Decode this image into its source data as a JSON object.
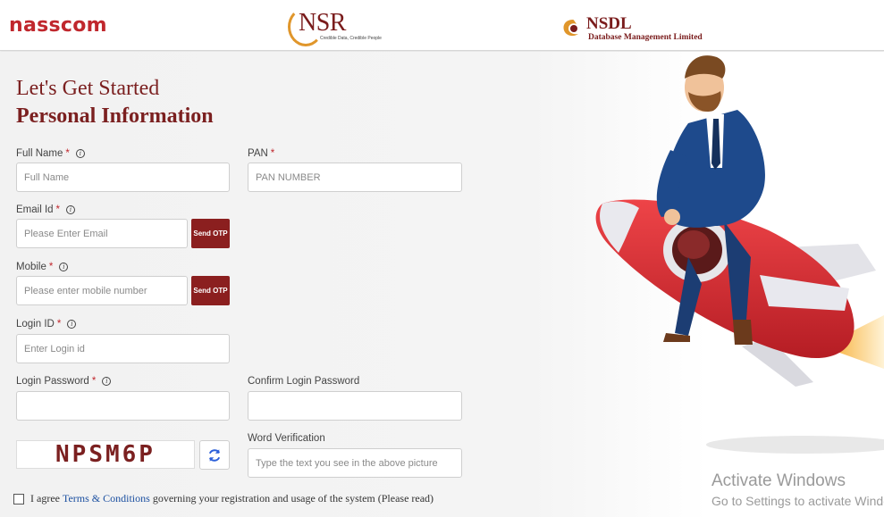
{
  "header": {
    "brand_nasscom": "nasscom",
    "brand_nsr": "NSR",
    "brand_nsr_tagline": "Credible Data, Credible People",
    "brand_nsdl": "NSDL",
    "brand_nsdl_sub": "Database Management Limited"
  },
  "form": {
    "title_line1": "Let's Get Started",
    "title_line2": "Personal Information",
    "required_mark": "*",
    "full_name": {
      "label": "Full Name",
      "placeholder": "Full Name",
      "value": ""
    },
    "pan": {
      "label": "PAN",
      "placeholder": "PAN NUMBER",
      "value": ""
    },
    "email": {
      "label": "Email Id",
      "placeholder": "Please Enter Email",
      "value": "",
      "otp_label": "Send OTP"
    },
    "mobile": {
      "label": "Mobile",
      "placeholder": "Please enter mobile number",
      "value": "",
      "otp_label": "Send OTP"
    },
    "login_id": {
      "label": "Login ID",
      "placeholder": "Enter Login id",
      "value": ""
    },
    "login_password": {
      "label": "Login Password",
      "placeholder": "",
      "value": ""
    },
    "confirm_password": {
      "label": "Confirm Login Password",
      "placeholder": "",
      "value": ""
    },
    "captcha": {
      "text": "NPSM6P",
      "refresh_icon": "refresh-icon"
    },
    "word_verification": {
      "label": "Word Verification",
      "placeholder": "Type the text you see in the above picture",
      "value": ""
    },
    "agree": {
      "prefix": "I agree",
      "link": "Terms & Conditions",
      "suffix": "governing your registration and usage of the system (Please read)",
      "checked": false
    }
  },
  "watermark": {
    "line1": "Activate Windows",
    "line2": "Go to Settings to activate Windows."
  },
  "colors": {
    "brand_red": "#c0272d",
    "title_maroon": "#7b2020",
    "button_maroon": "#8b1f1f",
    "link_blue": "#1b4fa0",
    "nsr_orange": "#e0962b"
  }
}
